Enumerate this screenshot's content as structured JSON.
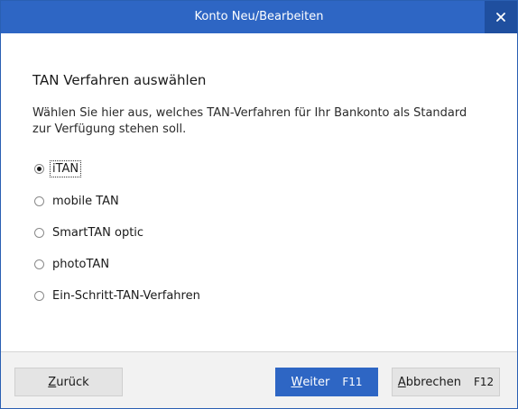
{
  "window": {
    "title": "Konto Neu/Bearbeiten",
    "close_icon": "close-icon"
  },
  "content": {
    "heading": "TAN Verfahren auswählen",
    "description": "Wählen Sie hier aus, welches TAN-Verfahren für Ihr Bankonto als Standard zur Verfügung stehen soll.",
    "options": [
      {
        "label": "iTAN",
        "selected": true
      },
      {
        "label": "mobile TAN",
        "selected": false
      },
      {
        "label": "SmartTAN optic",
        "selected": false
      },
      {
        "label": "photoTAN",
        "selected": false
      },
      {
        "label": "Ein-Schritt-TAN-Verfahren",
        "selected": false
      }
    ]
  },
  "footer": {
    "back": {
      "mnemonic": "Z",
      "rest": "urück",
      "key": ""
    },
    "next": {
      "mnemonic": "W",
      "rest": "eiter",
      "key": "F11"
    },
    "cancel": {
      "mnemonic": "A",
      "rest": "bbrechen",
      "key": "F12"
    }
  },
  "colors": {
    "accent": "#2e66c4",
    "close_bg": "#1f4f9f",
    "footer_bg": "#f2f2f2"
  }
}
